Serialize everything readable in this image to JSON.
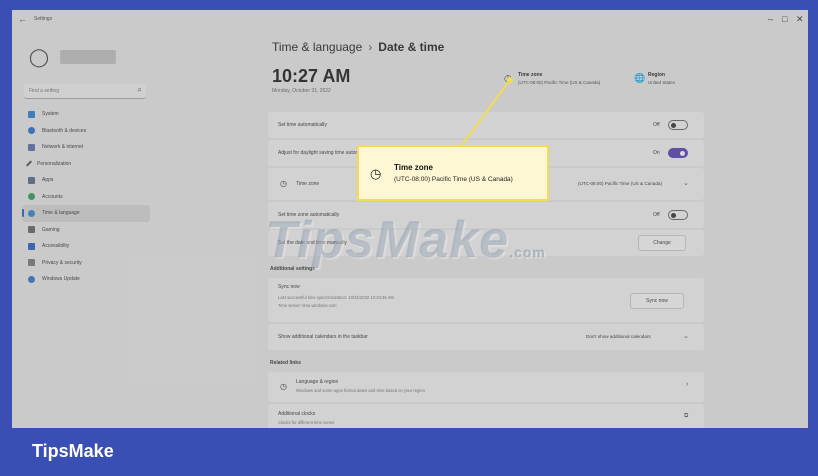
{
  "window": {
    "title": "Settings",
    "back_icon": "back-arrow-icon",
    "controls": [
      "–",
      "□",
      "✕"
    ]
  },
  "sidebar": {
    "search_placeholder": "Find a setting",
    "items": [
      {
        "label": "System",
        "icon": "monitor-icon",
        "color": "#2f7fd8"
      },
      {
        "label": "Bluetooth & devices",
        "icon": "bluetooth-icon",
        "color": "#2a6fcf"
      },
      {
        "label": "Network & internet",
        "icon": "wifi-icon",
        "color": "#5a6fb0"
      },
      {
        "label": "Personalization",
        "icon": "brush-icon",
        "color": "#555555"
      },
      {
        "label": "Apps",
        "icon": "apps-icon",
        "color": "#5b6b88"
      },
      {
        "label": "Accounts",
        "icon": "account-icon",
        "color": "#2f9e5b"
      },
      {
        "label": "Time & language",
        "icon": "globe-clock-icon",
        "color": "#2b8ad8",
        "active": true
      },
      {
        "label": "Gaming",
        "icon": "gamepad-icon",
        "color": "#666666"
      },
      {
        "label": "Accessibility",
        "icon": "accessibility-icon",
        "color": "#2a5fc8"
      },
      {
        "label": "Privacy & security",
        "icon": "shield-icon",
        "color": "#7a7a7a"
      },
      {
        "label": "Windows Update",
        "icon": "update-icon",
        "color": "#2a78d0"
      }
    ]
  },
  "breadcrumb": {
    "parent": "Time & language",
    "separator": "›",
    "current": "Date & time"
  },
  "header": {
    "time": "10:27 AM",
    "date": "Monday, October 31, 2022",
    "timezone_title": "Time zone",
    "timezone_value": "(UTC-08:00) Pacific Time (US & Canada)",
    "region_title": "Region",
    "region_value": "United States"
  },
  "settings": {
    "set_time_auto": {
      "label": "Set time automatically",
      "state": "Off"
    },
    "daylight": {
      "label": "Adjust for daylight saving time automatically",
      "state": "On"
    },
    "time_zone": {
      "label": "Time zone",
      "value": "(UTC-08:00) Pacific Time (US & Canada)"
    },
    "set_tz_auto": {
      "label": "Set time zone automatically",
      "state": "Off"
    },
    "manual": {
      "label": "Set the date and time manually",
      "button": "Change"
    }
  },
  "additional": {
    "heading": "Additional settings",
    "sync_title": "Sync now",
    "sync_sub1": "Last successful time synchronization: 10/31/2022 10:23:45 AM",
    "sync_sub2": "Time server: time.windows.com",
    "sync_button": "Sync now",
    "calendars_label": "Show additional calendars in the taskbar",
    "calendars_value": "Don't show additional calendars"
  },
  "related": {
    "heading": "Related links",
    "language_title": "Language & region",
    "language_sub": "Windows and some apps format dates and time based on your region",
    "clocks_title": "Additional clocks",
    "clocks_sub": "Clocks for different time zones"
  },
  "callout": {
    "title": "Time zone",
    "value": "(UTC-08:00) Pacific Time (US & Canada)",
    "border_color": "#f2dc50"
  },
  "watermark": {
    "text": "TipsMake",
    "suffix": ".com"
  },
  "footer": {
    "brand": "TipsMake"
  },
  "colors": {
    "frame": "#3a4fb3",
    "accent": "#5a3fb8",
    "callout_border": "#f2dc50"
  }
}
